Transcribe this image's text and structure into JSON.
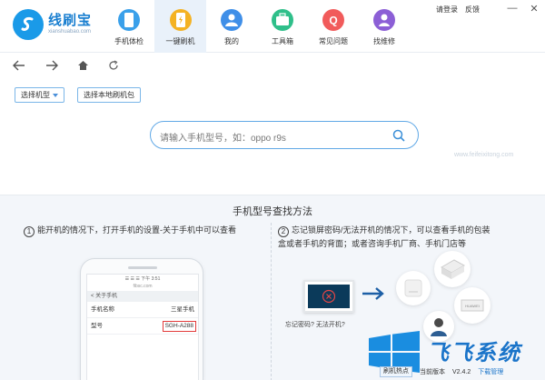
{
  "app": {
    "name": "线刷宝",
    "site": "xianshuabao.com"
  },
  "nav": [
    {
      "label": "手机体检",
      "icon": "phone-check-icon",
      "color": "#3aa0ea"
    },
    {
      "label": "一键刷机",
      "icon": "flash-phone-icon",
      "color": "#f4b223"
    },
    {
      "label": "我的",
      "icon": "user-icon",
      "color": "#3f8fe8"
    },
    {
      "label": "工具箱",
      "icon": "toolbox-icon",
      "color": "#2fbf8a"
    },
    {
      "label": "常见问题",
      "icon": "faq-icon",
      "color": "#f15b5b"
    },
    {
      "label": "找维修",
      "icon": "repair-icon",
      "color": "#8c5fd6"
    }
  ],
  "nav_active_index": 1,
  "header": {
    "login": "请登录",
    "feedback": "反馈"
  },
  "window": {
    "minimize": "—",
    "close": "✕"
  },
  "selects": {
    "model": "选择机型",
    "local_package": "选择本地刷机包"
  },
  "search": {
    "placeholder": "请输入手机型号，如：oppo r9s"
  },
  "help": {
    "title": "手机型号查找方法",
    "step1_num": "1",
    "step1": "能开机的情况下，打开手机的设置-关于手机中可以查看",
    "step2_num": "2",
    "step2_line1": "忘记锁屏密码/无法开机的情况下，可以查看手机的包装",
    "step2_line2": "盒或者手机的背面；或者咨询手机厂商、手机门店等"
  },
  "phone_screen": {
    "status": "☰ ☰ ☰    下午 3:51",
    "sub": "fibsc.com",
    "back": "< 关于手机",
    "row1_label": "手机名称",
    "row1_value": "三星手机",
    "row2_label": "型号",
    "row2_value": "SGH-A288"
  },
  "illustration": {
    "caption": "忘记密码? 无法开机?",
    "box_label": "HUAWEI"
  },
  "watermark": {
    "brand": "飞飞系统",
    "url": "www.feifeixitong.com"
  },
  "status_bar": {
    "hot": "刷机热点",
    "version_label": "当前版本",
    "version": "V2.4.2",
    "download": "下载管理"
  },
  "colors": {
    "accent": "#1a9ae8",
    "active_nav_bg": "#e9f1fa",
    "help_bg": "#f3f6fa"
  }
}
